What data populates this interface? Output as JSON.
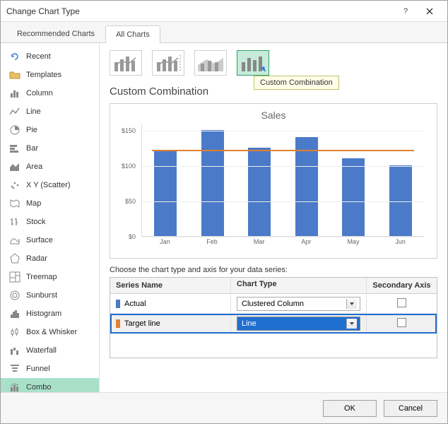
{
  "title": "Change Chart Type",
  "tabs": {
    "recommended": "Recommended Charts",
    "all": "All Charts"
  },
  "sidebar": {
    "items": [
      {
        "label": "Recent"
      },
      {
        "label": "Templates"
      },
      {
        "label": "Column"
      },
      {
        "label": "Line"
      },
      {
        "label": "Pie"
      },
      {
        "label": "Bar"
      },
      {
        "label": "Area"
      },
      {
        "label": "X Y (Scatter)"
      },
      {
        "label": "Map"
      },
      {
        "label": "Stock"
      },
      {
        "label": "Surface"
      },
      {
        "label": "Radar"
      },
      {
        "label": "Treemap"
      },
      {
        "label": "Sunburst"
      },
      {
        "label": "Histogram"
      },
      {
        "label": "Box & Whisker"
      },
      {
        "label": "Waterfall"
      },
      {
        "label": "Funnel"
      },
      {
        "label": "Combo"
      }
    ]
  },
  "section_title": "Custom Combination",
  "tooltip": "Custom Combination",
  "series_caption": "Choose the chart type and axis for your data series:",
  "table_head": {
    "name": "Series Name",
    "type": "Chart Type",
    "axis": "Secondary Axis"
  },
  "series": [
    {
      "name": "Actual",
      "chart_type": "Clustered Column",
      "color": "#4a7ac8",
      "secondary": false
    },
    {
      "name": "Target line",
      "chart_type": "Line",
      "color": "#e08030",
      "secondary": false
    }
  ],
  "buttons": {
    "ok": "OK",
    "cancel": "Cancel"
  },
  "chart_data": {
    "type": "bar",
    "title": "Sales",
    "categories": [
      "Jan",
      "Feb",
      "Mar",
      "Apr",
      "May",
      "Jun"
    ],
    "series": [
      {
        "name": "Actual",
        "type": "bar",
        "color": "#4a7ac8",
        "values": [
          120,
          150,
          125,
          140,
          110,
          100
        ]
      },
      {
        "name": "Target line",
        "type": "line",
        "color": "#e08030",
        "values": [
          120,
          120,
          120,
          120,
          120,
          120
        ]
      }
    ],
    "ylabel": "",
    "xlabel": "",
    "ylim": [
      0,
      160
    ],
    "yticks": [
      0,
      50,
      100,
      150
    ]
  }
}
